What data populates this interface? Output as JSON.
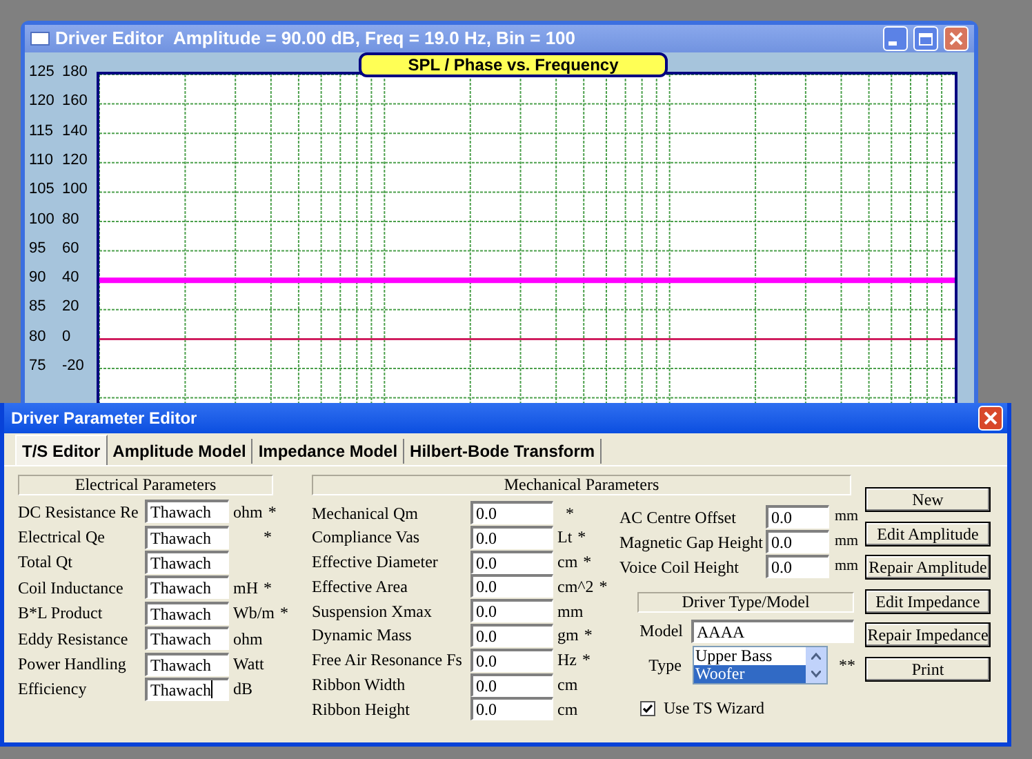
{
  "main_window": {
    "title": "Driver Editor  Amplitude = 90.00 dB, Freq = 19.0 Hz, Bin = 100",
    "chart": {
      "title": "SPL / Phase vs. Frequency",
      "spl_ticks": [
        "125",
        "120",
        "115",
        "110",
        "105",
        "100",
        "95",
        "90",
        "85",
        "80",
        "75"
      ],
      "phase_ticks": [
        "180",
        "160",
        "140",
        "120",
        "100",
        "80",
        "60",
        "40",
        "20",
        "0",
        "-20"
      ]
    }
  },
  "dialog": {
    "title": "Driver Parameter Editor",
    "tabs": [
      {
        "label": "T/S Editor",
        "selected": true
      },
      {
        "label": "Amplitude Model",
        "selected": false
      },
      {
        "label": "Impedance Model",
        "selected": false
      },
      {
        "label": "Hilbert-Bode Transform",
        "selected": false
      }
    ],
    "electrical": {
      "header": "Electrical Parameters",
      "rows": [
        {
          "label": "DC Resistance Re",
          "value": "Thawach",
          "unit": "ohm",
          "mark": "*",
          "focused": false
        },
        {
          "label": "Electrical Qe",
          "value": "Thawach",
          "mark": "*",
          "focused": false
        },
        {
          "label": "Total Qt",
          "value": "Thawach",
          "focused": false
        },
        {
          "label": "Coil Inductance",
          "value": "Thawach",
          "unit": "mH",
          "mark": "*",
          "focused": false
        },
        {
          "label": "B*L Product",
          "value": "Thawach",
          "unit": "Wb/m",
          "mark": "*",
          "focused": false
        },
        {
          "label": "Eddy Resistance",
          "value": "Thawach",
          "unit": "ohm",
          "focused": false
        },
        {
          "label": "Power Handling",
          "value": "Thawach",
          "unit": "Watt",
          "focused": false
        },
        {
          "label": "Efficiency",
          "value": "Thawach",
          "unit": "dB",
          "focused": true
        }
      ]
    },
    "mechanical": {
      "header": "Mechanical Parameters",
      "rows": [
        {
          "label": "Mechanical Qm",
          "value": "0.0",
          "mark": "*"
        },
        {
          "label": "Compliance Vas",
          "value": "0.0",
          "unit": "Lt",
          "mark": "*"
        },
        {
          "label": "Effective Diameter",
          "value": "0.0",
          "unit": "cm",
          "mark": "*"
        },
        {
          "label": "Effective Area",
          "value": "0.0",
          "unit": "cm^2",
          "mark": "*"
        },
        {
          "label": "Suspension Xmax",
          "value": "0.0",
          "unit": "mm"
        },
        {
          "label": "Dynamic Mass",
          "value": "0.0",
          "unit": "gm",
          "mark": "*"
        },
        {
          "label": "Free Air Resonance Fs",
          "value": "0.0",
          "unit": "Hz",
          "mark": "*"
        },
        {
          "label": "Ribbon Width",
          "value": "0.0",
          "unit": "cm"
        },
        {
          "label": "Ribbon Height",
          "value": "0.0",
          "unit": "cm"
        }
      ],
      "extra_rows": [
        {
          "label": "AC Centre Offset",
          "value": "0.0",
          "unit": "mm"
        },
        {
          "label": "Magnetic Gap Height",
          "value": "0.0",
          "unit": "mm"
        },
        {
          "label": "Voice Coil Height",
          "value": "0.0",
          "unit": "mm"
        }
      ]
    },
    "driver_type": {
      "header": "Driver Type/Model",
      "model_label": "Model",
      "model_value": "AAAA",
      "type_label": "Type",
      "type_options": [
        {
          "label": "Upper Bass",
          "selected": false
        },
        {
          "label": "Woofer",
          "selected": true
        }
      ],
      "type_mark": "**",
      "wizard": {
        "label": "Use TS Wizard",
        "checked": true
      }
    },
    "buttons": [
      "New",
      "Edit Amplitude",
      "Repair Amplitude",
      "Edit Impedance",
      "Repair Impedance",
      "Print"
    ]
  }
}
